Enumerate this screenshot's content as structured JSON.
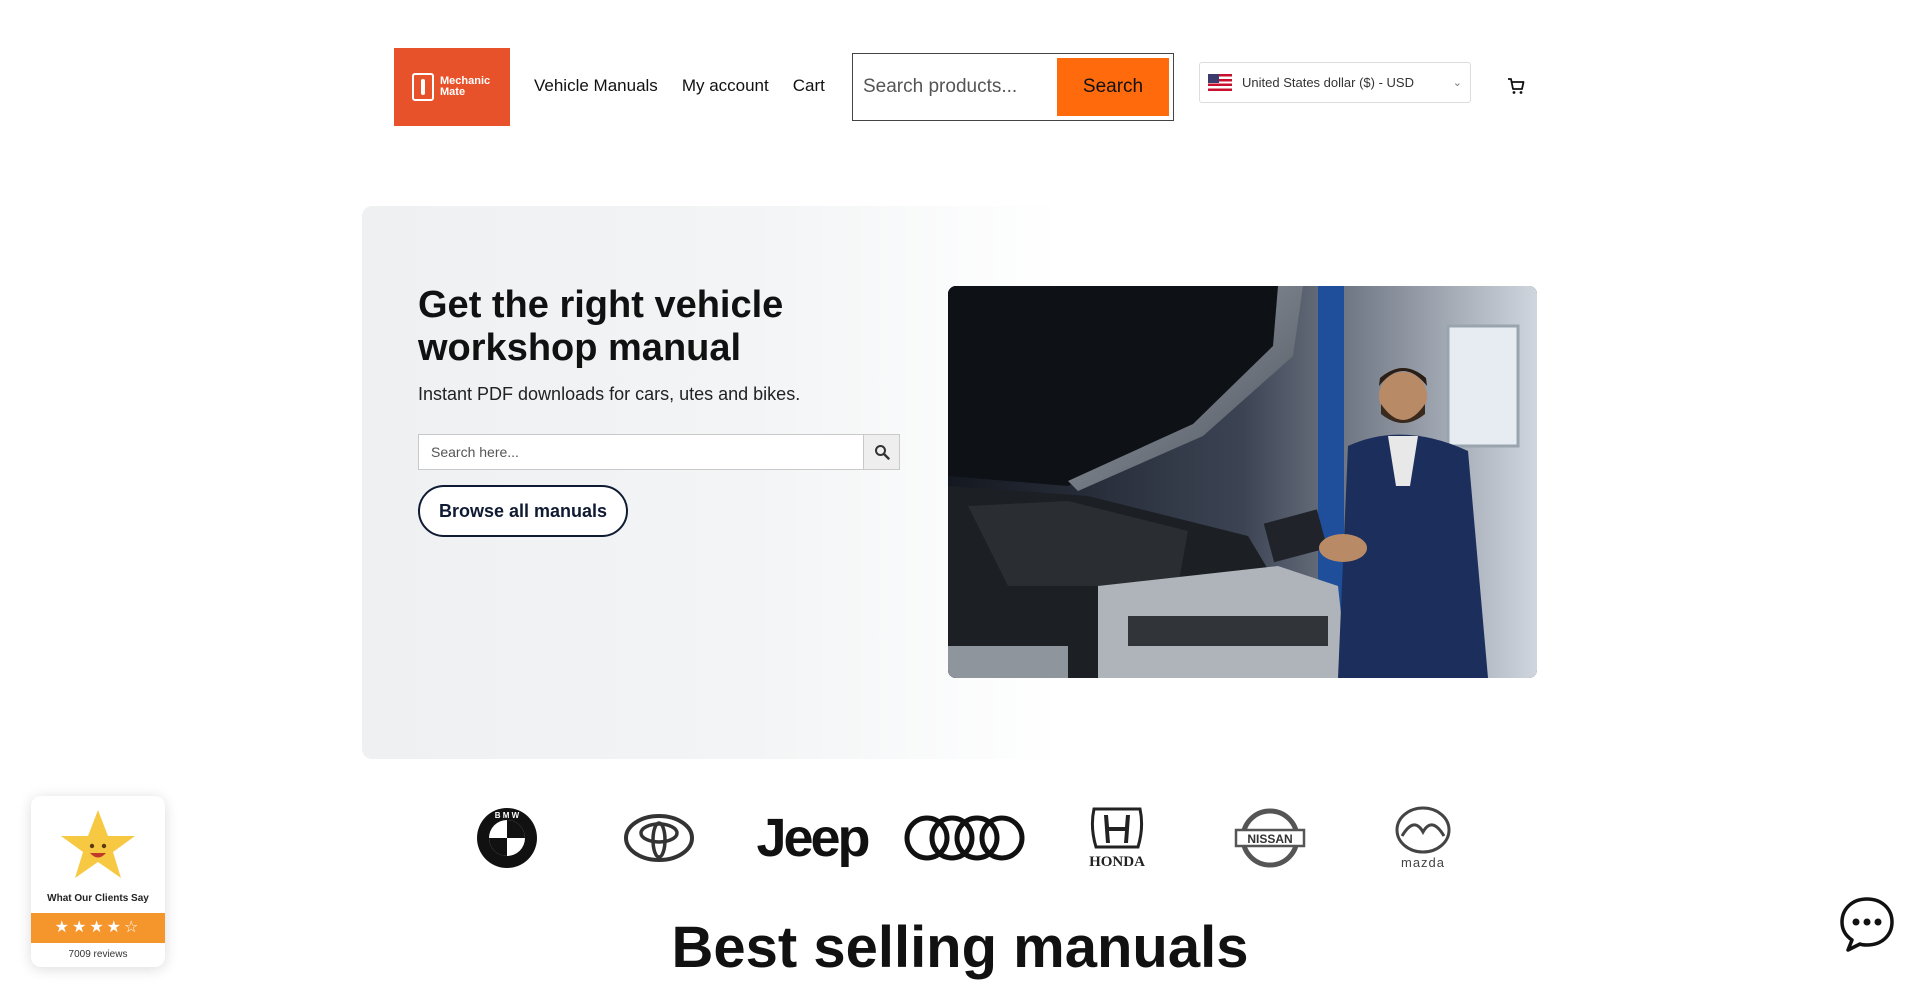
{
  "header": {
    "logo_text": "Mechanic Mate",
    "nav": [
      "Vehicle Manuals",
      "My account",
      "Cart"
    ],
    "search_placeholder": "Search products...",
    "search_button": "Search",
    "currency": "United States dollar ($) - USD"
  },
  "hero": {
    "title": "Get the right vehicle workshop manual",
    "subtitle": "Instant PDF downloads for cars, utes and bikes.",
    "search_placeholder": "Search here...",
    "browse_button": "Browse all manuals"
  },
  "brands": [
    "BMW",
    "Toyota",
    "Jeep",
    "Audi",
    "Honda",
    "Nissan",
    "Mazda"
  ],
  "section_title": "Best selling manuals",
  "reviews": {
    "title": "What Our Clients Say",
    "stars": "★★★★☆",
    "count": "7009 reviews"
  },
  "colors": {
    "brand_orange": "#ff6a0d",
    "logo_bg": "#e8522a",
    "navy": "#0f1a33",
    "review_bar": "#f5962d"
  }
}
